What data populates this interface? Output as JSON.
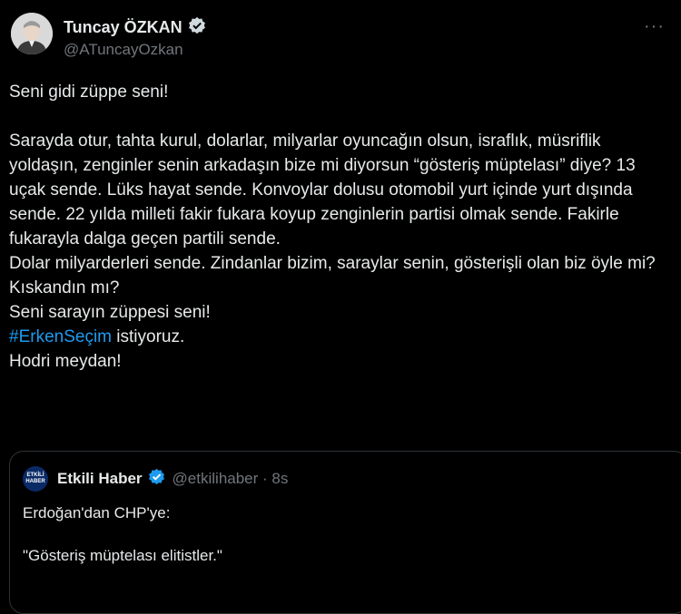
{
  "author": {
    "name": "Tuncay ÖZKAN",
    "handle": "@ATuncayOzkan",
    "verified_color": "#1d9bf0"
  },
  "more_label": "···",
  "tweet": {
    "line1": "Seni gidi züppe seni!",
    "para1": "Sarayda otur, tahta kurul, dolarlar, milyarlar oyuncağın olsun, israflık, müsriflik yoldaşın, zenginler senin arkadaşın bize mi diyorsun “gösteriş müptelası” diye? 13 uçak sende. Lüks hayat sende. Konvoylar dolusu otomobil yurt içinde yurt dışında sende. 22 yılda milleti fakir fukara koyup zenginlerin partisi olmak sende. Fakirle fukarayla dalga geçen partili sende.",
    "line_dolar": "Dolar milyarderleri sende. Zindanlar bizim, saraylar senin, gösterişli olan biz öyle mi?",
    "line_kiskandin": "Kıskandın mı?",
    "line_sarayin": "Seni sarayın züppesi seni!",
    "hashtag": "#ErkenSeçim",
    "hashtag_rest": " istiyoruz.",
    "line_hodri": "Hodri meydan!",
    "hashtag_color": "#1d9bf0"
  },
  "quote": {
    "name": "Etkili Haber",
    "handle": "@etkilihaber · 8s",
    "avatar_top": "ETKİLİ",
    "avatar_bottom": "HABER",
    "line1": "Erdoğan'dan CHP'ye:",
    "line2": "\"Gösteriş müptelası elitistler.\""
  }
}
